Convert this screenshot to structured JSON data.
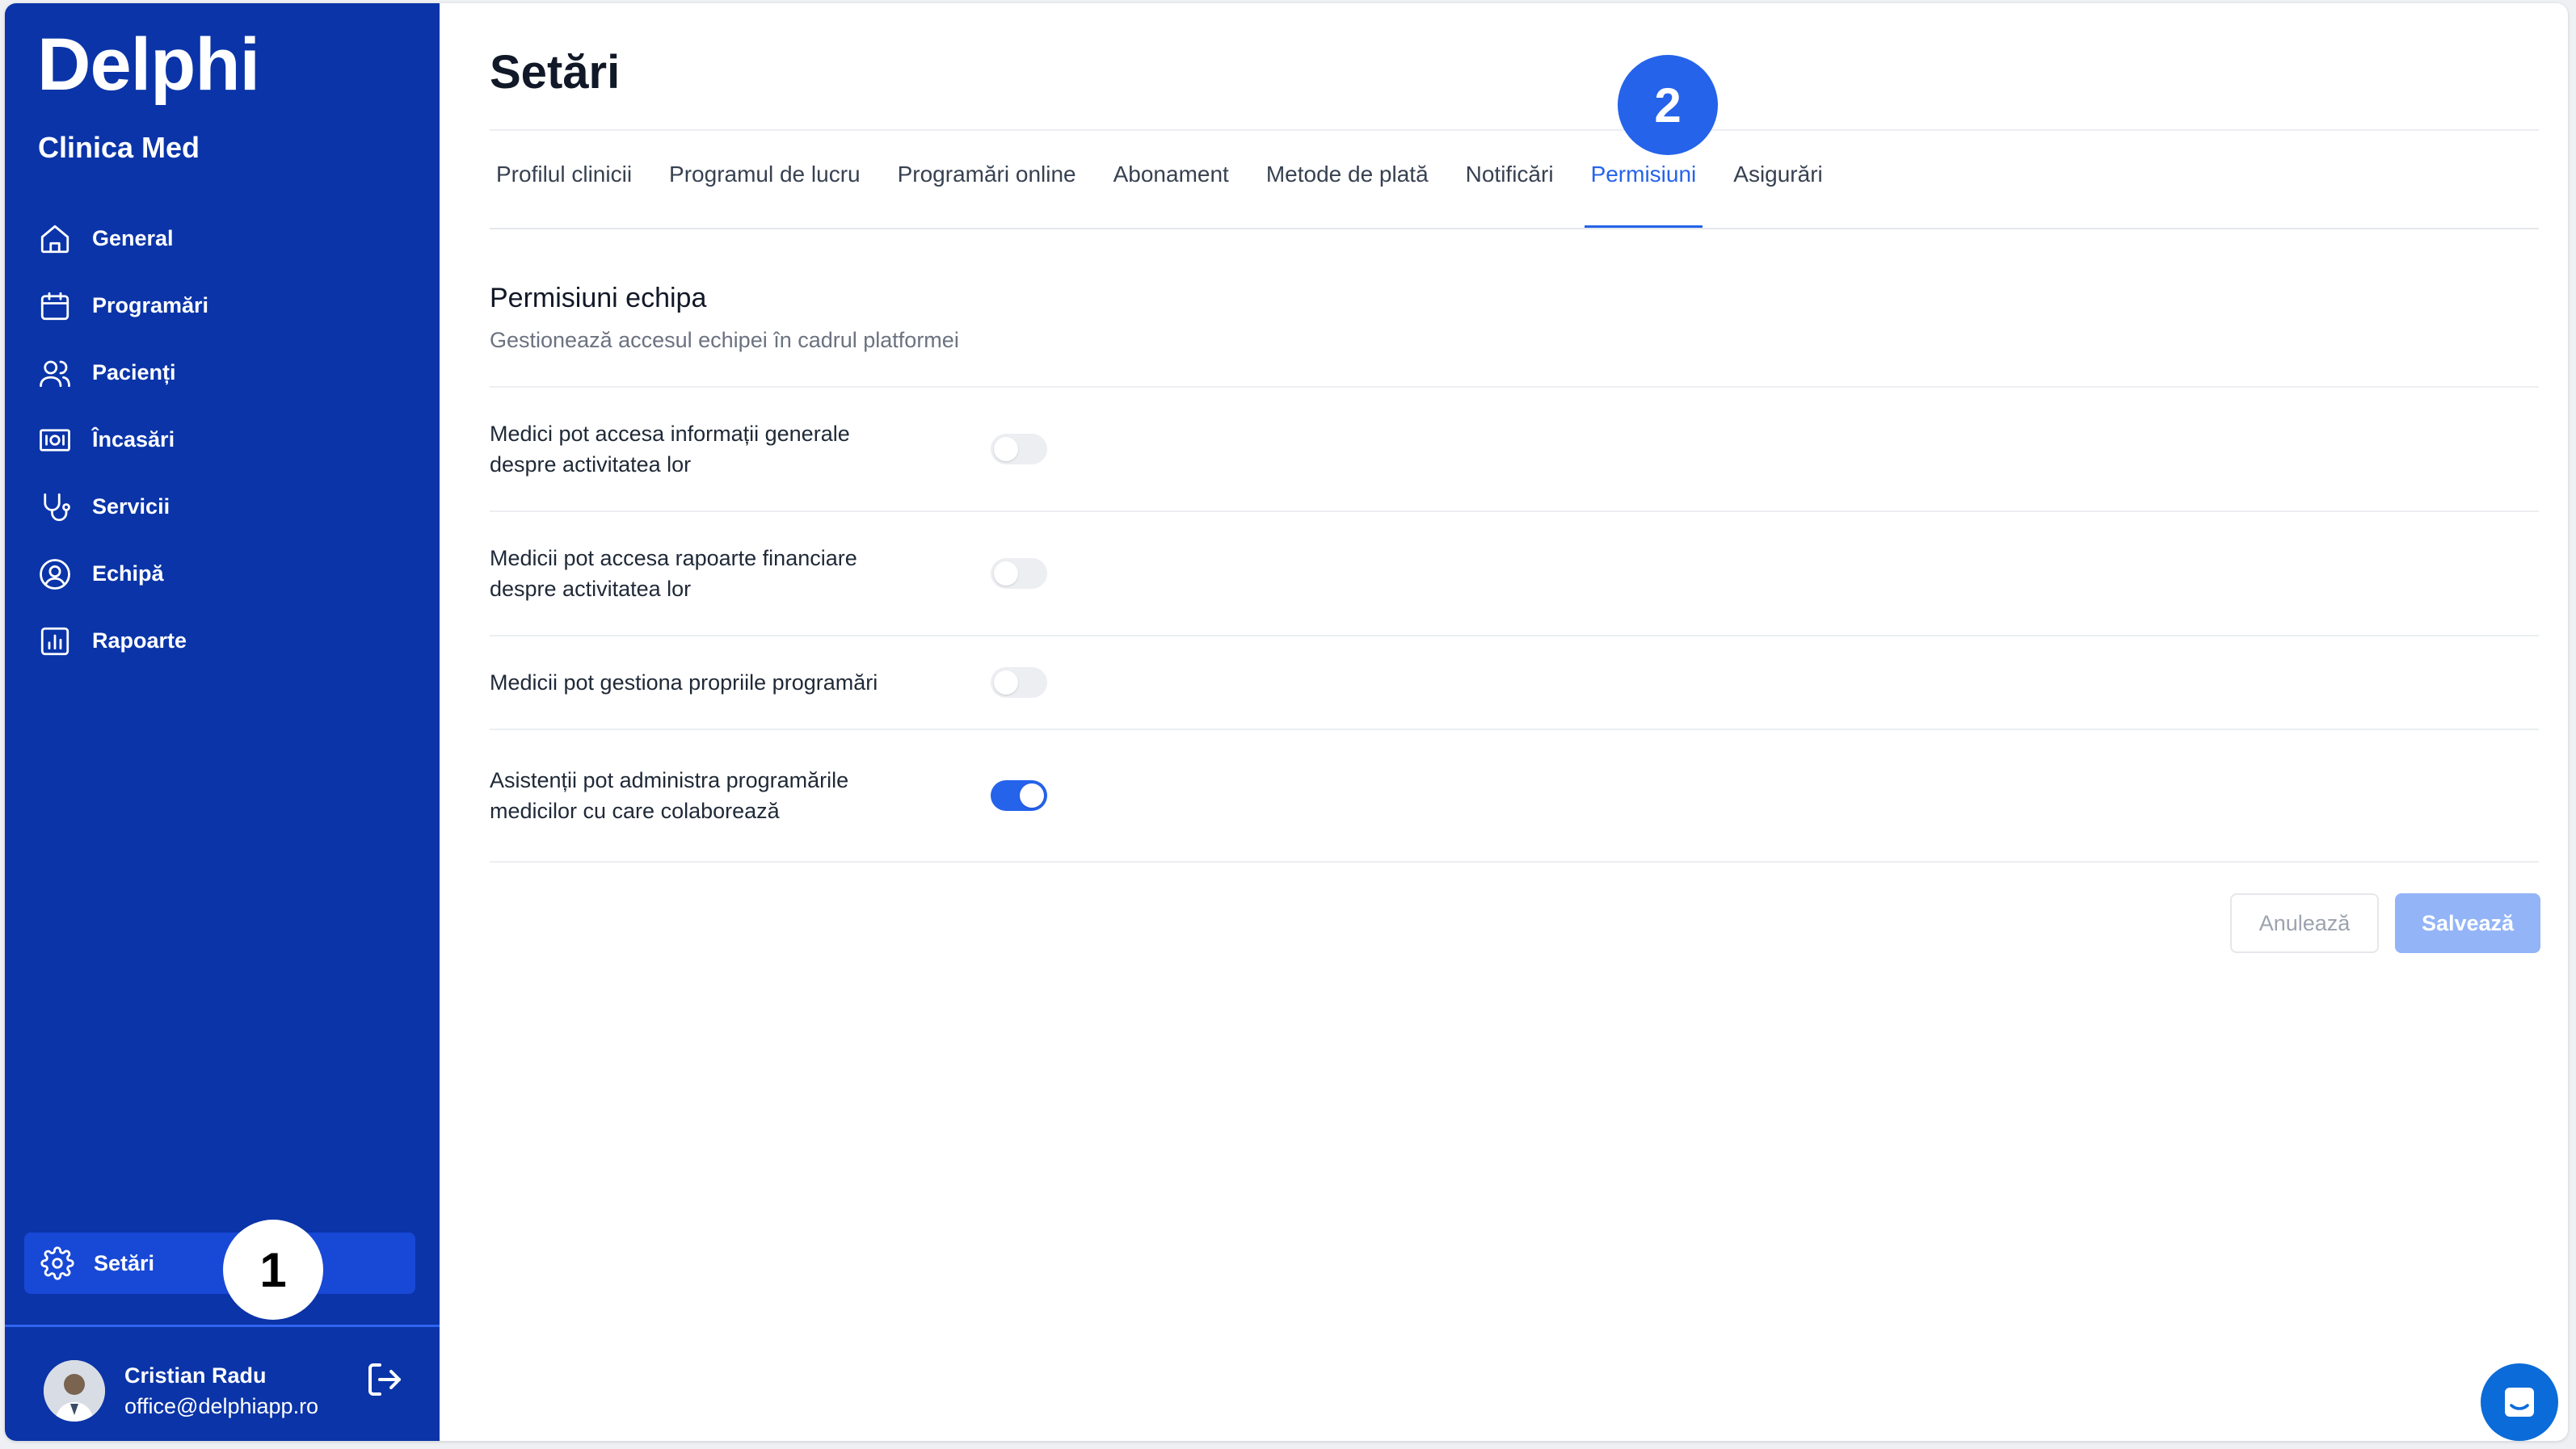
{
  "app": {
    "brand": "Delphi",
    "clinic": "Clinica Med"
  },
  "sidebar": {
    "items": [
      {
        "label": "General",
        "icon": "home-icon"
      },
      {
        "label": "Programări",
        "icon": "calendar-icon"
      },
      {
        "label": "Pacienți",
        "icon": "users-icon"
      },
      {
        "label": "Încasări",
        "icon": "money-icon"
      },
      {
        "label": "Servicii",
        "icon": "stethoscope-icon"
      },
      {
        "label": "Echipă",
        "icon": "user-circle-icon"
      },
      {
        "label": "Rapoarte",
        "icon": "chart-icon"
      }
    ],
    "settings_label": "Setări",
    "user": {
      "name": "Cristian Radu",
      "email": "office@delphiapp.ro"
    }
  },
  "badges": {
    "one": "1",
    "two": "2"
  },
  "main": {
    "title": "Setări",
    "tabs": [
      {
        "label": "Profilul clinicii",
        "active": false
      },
      {
        "label": "Programul de lucru",
        "active": false
      },
      {
        "label": "Programări online",
        "active": false
      },
      {
        "label": "Abonament",
        "active": false
      },
      {
        "label": "Metode de plată",
        "active": false
      },
      {
        "label": "Notificări",
        "active": false
      },
      {
        "label": "Permisiuni",
        "active": true
      },
      {
        "label": "Asigurări",
        "active": false
      }
    ],
    "section": {
      "title": "Permisiuni echipa",
      "subtitle": "Gestionează accesul echipei în cadrul platformei"
    },
    "permissions": [
      {
        "line1": "Medici pot accesa informații generale",
        "line2": "despre activitatea lor",
        "enabled": false
      },
      {
        "line1": "Medicii pot accesa rapoarte financiare",
        "line2": "despre activitatea lor",
        "enabled": false
      },
      {
        "line1": "Medicii pot gestiona propriile programări",
        "line2": "",
        "enabled": false
      },
      {
        "line1": "Asistenții pot administra programările",
        "line2": "medicilor cu care colaborează",
        "enabled": true
      }
    ],
    "buttons": {
      "cancel": "Anulează",
      "save": "Salvează"
    }
  },
  "colors": {
    "sidebar_bg": "#0a34a8",
    "accent": "#2563eb",
    "save_disabled": "#93b4f7"
  }
}
